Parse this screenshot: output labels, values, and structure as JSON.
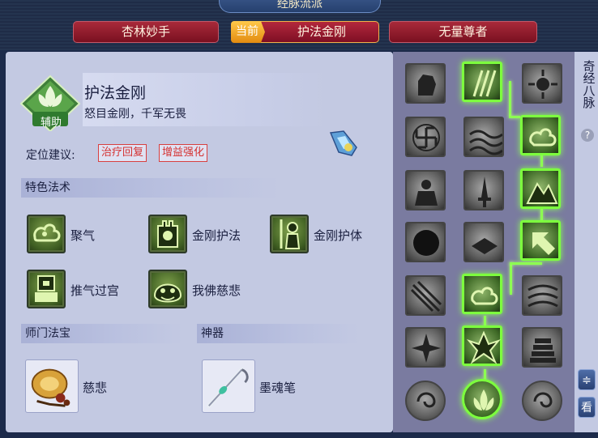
{
  "window": {
    "title": "经脉流派"
  },
  "tabs": [
    {
      "label": "杏林妙手",
      "active": false
    },
    {
      "label": "护法金刚",
      "active": true,
      "badge": "当前"
    },
    {
      "label": "无量尊者",
      "active": false
    }
  ],
  "school": {
    "role_badge": "辅助",
    "name": "护法金刚",
    "motto": "怒目金刚，千军无畏"
  },
  "position": {
    "label": "定位建议:",
    "tags": [
      "治疗回复",
      "增益强化"
    ]
  },
  "skills_section": {
    "title": "特色法术",
    "items": [
      {
        "label": "聚气",
        "icon": "cloud-swirl-icon"
      },
      {
        "label": "金刚护法",
        "icon": "tower-icon"
      },
      {
        "label": "金刚护体",
        "icon": "guardian-icon"
      },
      {
        "label": "推气过宫",
        "icon": "seal-icon"
      },
      {
        "label": "我佛慈悲",
        "icon": "buddha-face-icon"
      }
    ]
  },
  "treasure": {
    "title": "师门法宝",
    "item": "慈悲",
    "icon": "prayer-beads-icon"
  },
  "artifact": {
    "title": "神器",
    "item": "墨魂笔",
    "icon": "brush-icon"
  },
  "meridian_tree": {
    "rows": [
      [
        {
          "icon": "fist-icon",
          "lit": false
        },
        {
          "icon": "claw-slash-icon",
          "lit": true
        },
        {
          "icon": "sunburst-icon",
          "lit": false
        }
      ],
      [
        {
          "icon": "swastika-icon",
          "lit": false
        },
        {
          "icon": "waves-icon",
          "lit": false
        },
        {
          "icon": "cloud-swirl-icon",
          "lit": true
        }
      ],
      [
        {
          "icon": "monk-icon",
          "lit": false
        },
        {
          "icon": "dagger-icon",
          "lit": false
        },
        {
          "icon": "mountain-icon",
          "lit": true
        }
      ],
      [
        {
          "icon": "dark-orb-icon",
          "lit": false
        },
        {
          "icon": "book-icon",
          "lit": false
        },
        {
          "icon": "arrow-up-left-icon",
          "lit": true
        }
      ],
      [
        {
          "icon": "spears-icon",
          "lit": false
        },
        {
          "icon": "cloud-swirl-icon",
          "lit": true
        },
        {
          "icon": "wind-streaks-icon",
          "lit": false
        }
      ],
      [
        {
          "icon": "burst-icon",
          "lit": false
        },
        {
          "icon": "flame-burst-icon",
          "lit": true
        },
        {
          "icon": "stupa-icon",
          "lit": false
        }
      ],
      [
        {
          "icon": "spiral-disc-icon",
          "lit": false
        },
        {
          "icon": "lotus-disc-icon",
          "lit": true
        },
        {
          "icon": "spiral-disc-icon",
          "lit": false
        }
      ]
    ]
  },
  "side": {
    "label": "奇经八脉",
    "help": "?",
    "swap": "≑",
    "view": "看"
  },
  "colors": {
    "accent_green": "#7dff3e",
    "tag_red": "#d43030",
    "tab_red": "#9a1d2e",
    "current_gold": "#f0a12a"
  }
}
